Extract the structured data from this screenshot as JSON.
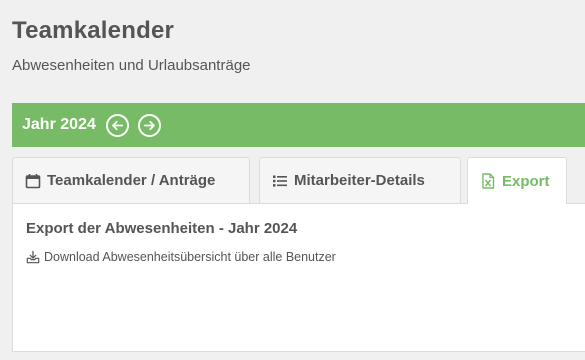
{
  "header": {
    "title": "Teamkalender",
    "subtitle": "Abwesenheiten und Urlaubsanträge"
  },
  "year_nav": {
    "label": "Jahr 2024",
    "prev_icon": "arrow-left-circle-icon",
    "next_icon": "arrow-right-circle-icon"
  },
  "tabs": [
    {
      "label": "Teamkalender / Anträge",
      "icon": "calendar-icon",
      "active": false
    },
    {
      "label": "Mitarbeiter-Details",
      "icon": "list-icon",
      "active": false
    },
    {
      "label": "Export",
      "icon": "excel-file-icon",
      "active": true
    }
  ],
  "export_panel": {
    "title": "Export der Abwesenheiten - Jahr 2024",
    "download_label": "Download Abwesenheitsübersicht über alle Benutzer",
    "download_icon": "download-icon"
  },
  "colors": {
    "accent_green": "#77bb66",
    "text": "#555555"
  }
}
